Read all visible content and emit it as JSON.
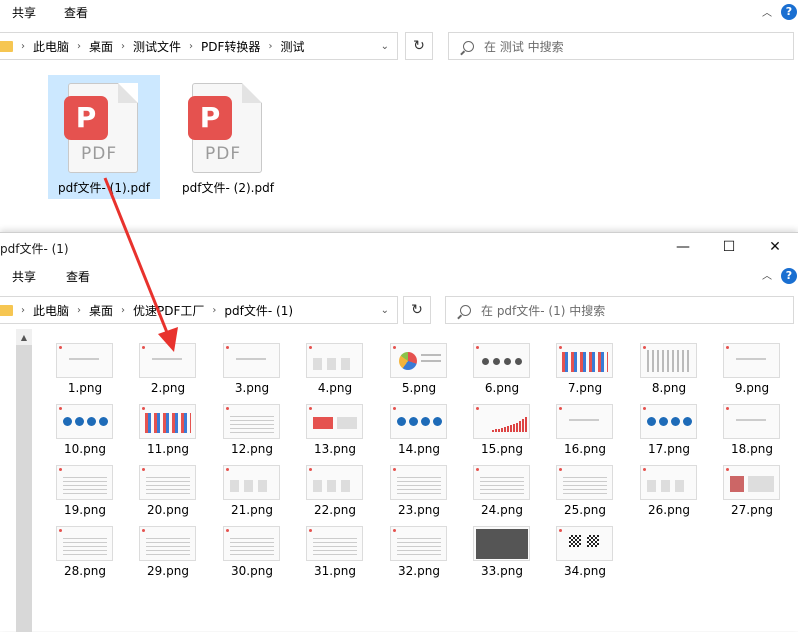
{
  "back_window": {
    "ribbon": {
      "share": "共享",
      "view": "查看"
    },
    "address": [
      "此电脑",
      "桌面",
      "测试文件",
      "PDF转换器",
      "测试"
    ],
    "search_placeholder": "在 测试 中搜索",
    "files": [
      {
        "name": "pdf文件- (1).pdf",
        "selected": true
      },
      {
        "name": "pdf文件- (2).pdf",
        "selected": false
      }
    ]
  },
  "front_window": {
    "title": "pdf文件- (1)",
    "ribbon": {
      "share": "共享",
      "view": "查看"
    },
    "address": [
      "此电脑",
      "桌面",
      "优速PDF工厂",
      "pdf文件- (1)"
    ],
    "search_placeholder": "在 pdf文件- (1) 中搜索",
    "thumbnails": [
      "1.png",
      "2.png",
      "3.png",
      "4.png",
      "5.png",
      "6.png",
      "7.png",
      "8.png",
      "9.png",
      "10.png",
      "11.png",
      "12.png",
      "13.png",
      "14.png",
      "15.png",
      "16.png",
      "17.png",
      "18.png",
      "19.png",
      "20.png",
      "21.png",
      "22.png",
      "23.png",
      "24.png",
      "25.png",
      "26.png",
      "27.png",
      "28.png",
      "29.png",
      "30.png",
      "31.png",
      "32.png",
      "33.png",
      "34.png"
    ]
  },
  "icons": {
    "pdf_badge_glyph": "P",
    "pdf_text": "PDF",
    "minimize": "—",
    "maximize": "☐",
    "close": "✕",
    "refresh": "↻",
    "help": "?"
  },
  "colors": {
    "pdf_red": "#e5524f",
    "selection": "#cce8ff",
    "arrow": "#e8322d",
    "folder": "#f6c652",
    "help_blue": "#1a6fd1"
  }
}
